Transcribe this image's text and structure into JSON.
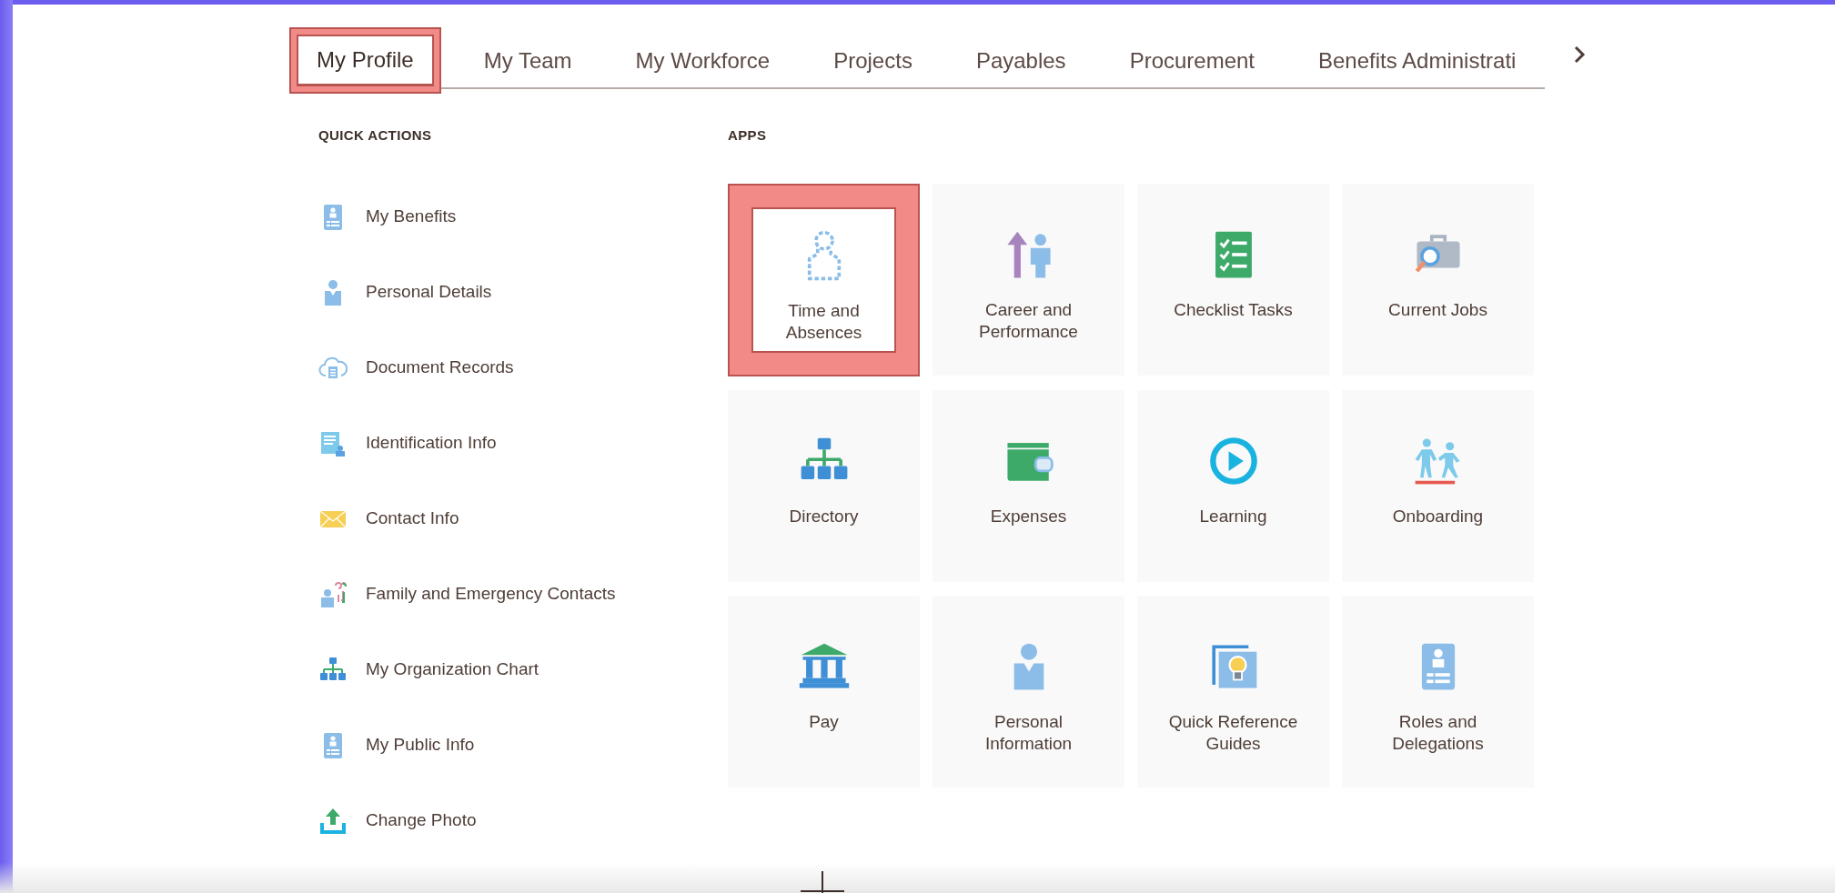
{
  "tabs": [
    {
      "label": "My Profile",
      "selected": true,
      "highlighted": true
    },
    {
      "label": "My Team",
      "selected": false,
      "highlighted": false
    },
    {
      "label": "My Workforce",
      "selected": false,
      "highlighted": false
    },
    {
      "label": "Projects",
      "selected": false,
      "highlighted": false
    },
    {
      "label": "Payables",
      "selected": false,
      "highlighted": false
    },
    {
      "label": "Procurement",
      "selected": false,
      "highlighted": false
    },
    {
      "label": "Benefits Administrati",
      "selected": false,
      "highlighted": false
    }
  ],
  "quick_actions": {
    "heading": "QUICK ACTIONS",
    "items": [
      {
        "kind": "id-card",
        "label": "My Benefits"
      },
      {
        "kind": "person",
        "label": "Personal Details"
      },
      {
        "kind": "cloud-doc",
        "label": "Document Records"
      },
      {
        "kind": "id-doc",
        "label": "Identification Info"
      },
      {
        "kind": "envelope",
        "label": "Contact Info"
      },
      {
        "kind": "family",
        "label": "Family and Emergency Contacts"
      },
      {
        "kind": "org-chart",
        "label": "My Organization Chart"
      },
      {
        "kind": "id-card",
        "label": "My Public Info"
      },
      {
        "kind": "upload",
        "label": "Change Photo"
      }
    ]
  },
  "apps": {
    "heading": "APPS",
    "items": [
      {
        "kind": "dashed-person",
        "label": "Time and\nAbsences",
        "highlighted": true
      },
      {
        "kind": "career",
        "label": "Career and\nPerformance",
        "highlighted": false
      },
      {
        "kind": "checklist",
        "label": "Checklist Tasks",
        "highlighted": false
      },
      {
        "kind": "briefcase-search",
        "label": "Current Jobs",
        "highlighted": false
      },
      {
        "kind": "org-chart",
        "label": "Directory",
        "highlighted": false
      },
      {
        "kind": "wallet",
        "label": "Expenses",
        "highlighted": false
      },
      {
        "kind": "play-circle",
        "label": "Learning",
        "highlighted": false
      },
      {
        "kind": "people",
        "label": "Onboarding",
        "highlighted": false
      },
      {
        "kind": "bank",
        "label": "Pay",
        "highlighted": false
      },
      {
        "kind": "person",
        "label": "Personal\nInformation",
        "highlighted": false
      },
      {
        "kind": "bulb",
        "label": "Quick Reference\nGuides",
        "highlighted": false
      },
      {
        "kind": "id-card",
        "label": "Roles and\nDelegations",
        "highlighted": false
      }
    ]
  }
}
